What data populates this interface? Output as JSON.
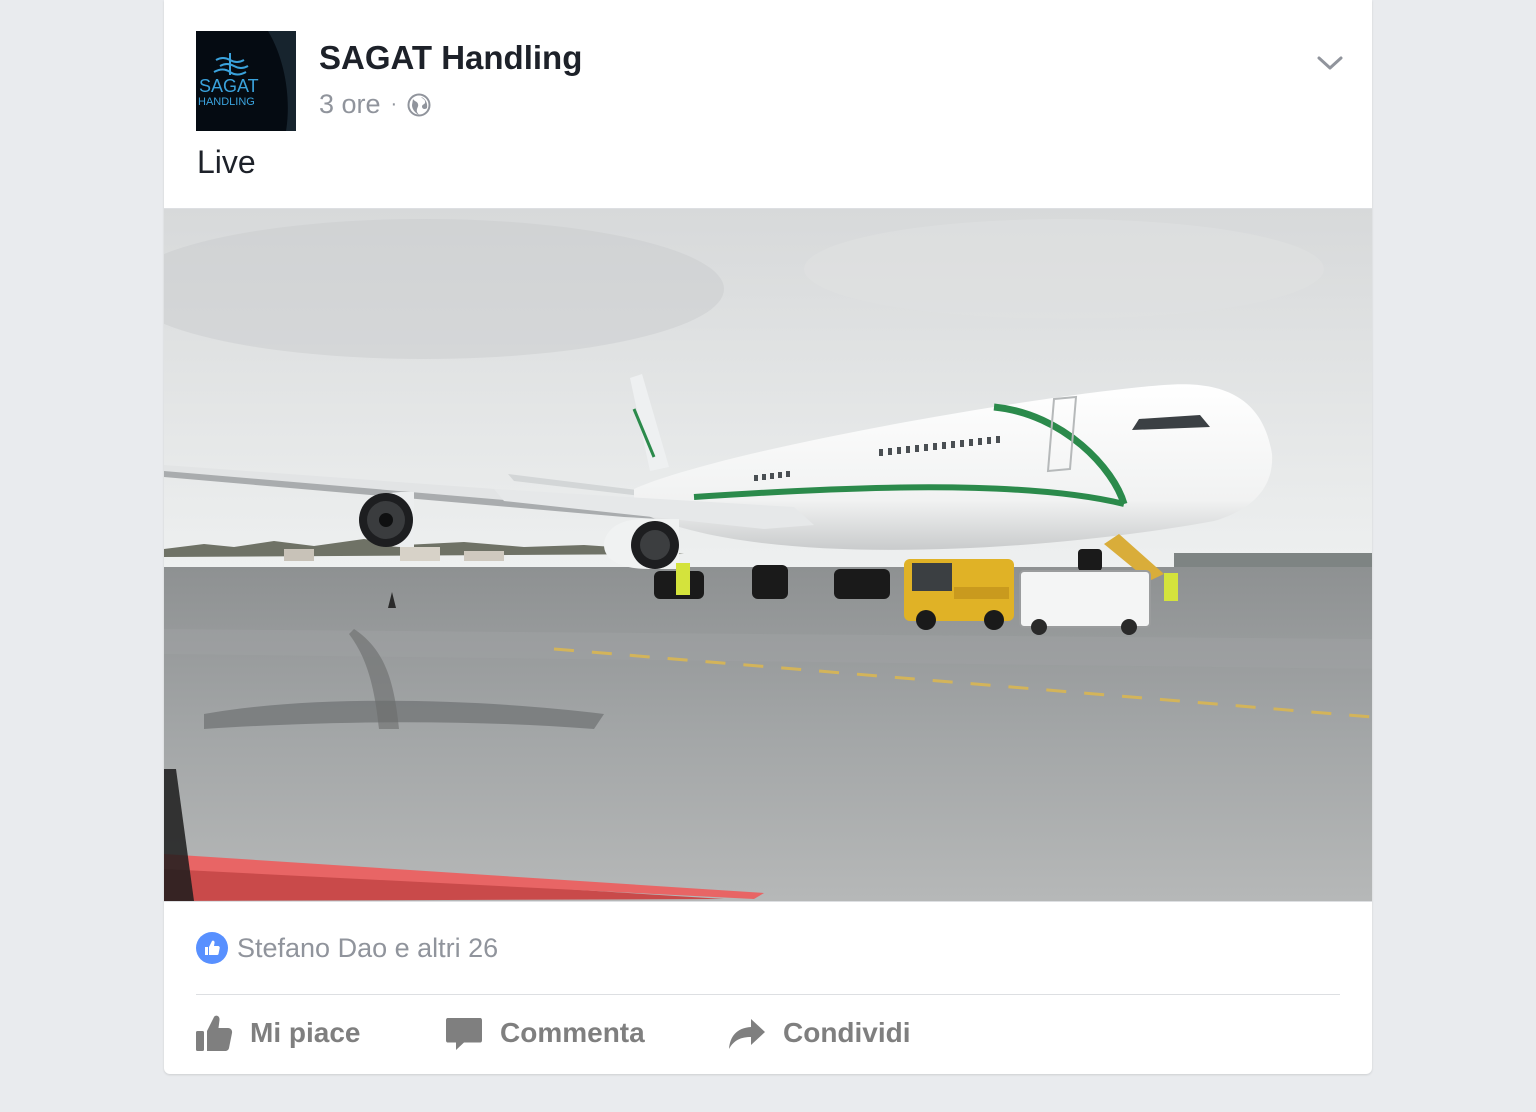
{
  "post": {
    "author": "SAGAT Handling",
    "avatar_text": [
      "SAGAT",
      "HANDLING"
    ],
    "timestamp": "3 ore",
    "separator": "·",
    "privacy_icon": "globe-icon",
    "menu_icon": "chevron-down-icon",
    "text": "Live",
    "photo_description": "Airliner on a wet apron"
  },
  "reactions": {
    "icon": "like-badge-icon",
    "summary": "Stefano Dao e altri 26"
  },
  "actions": [
    {
      "label": "Mi piace",
      "icon": "thumbs-up-icon"
    },
    {
      "label": "Commenta",
      "icon": "comment-bubble-icon"
    },
    {
      "label": "Condividi",
      "icon": "share-arrow-icon"
    }
  ],
  "colors": {
    "page_background": "#e9ebee",
    "card": "#ffffff",
    "text_primary": "#1d2129",
    "text_secondary": "#90949c",
    "like_blue": "#5890ff",
    "action_gray": "#7f7f7f"
  }
}
